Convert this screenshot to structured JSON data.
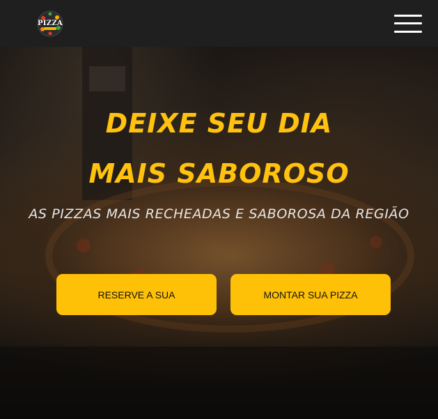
{
  "navbar": {
    "logo_text": "PIZZA",
    "menu_icon": "hamburger-menu-icon"
  },
  "hero": {
    "headline_line1": "DEIXE SEU DIA",
    "headline_line2": "MAIS SABOROSO",
    "subtitle": "AS PIZZAS MAIS RECHEADAS E SABOROSA DA REGIÃO",
    "reserve_button_label": "RESERVE A SUA",
    "build_button_label": "MONTAR SUA PIZZA"
  },
  "colors": {
    "accent": "#ffc107",
    "navbar": "#1f1f1f",
    "headline": "#ffc20e"
  }
}
